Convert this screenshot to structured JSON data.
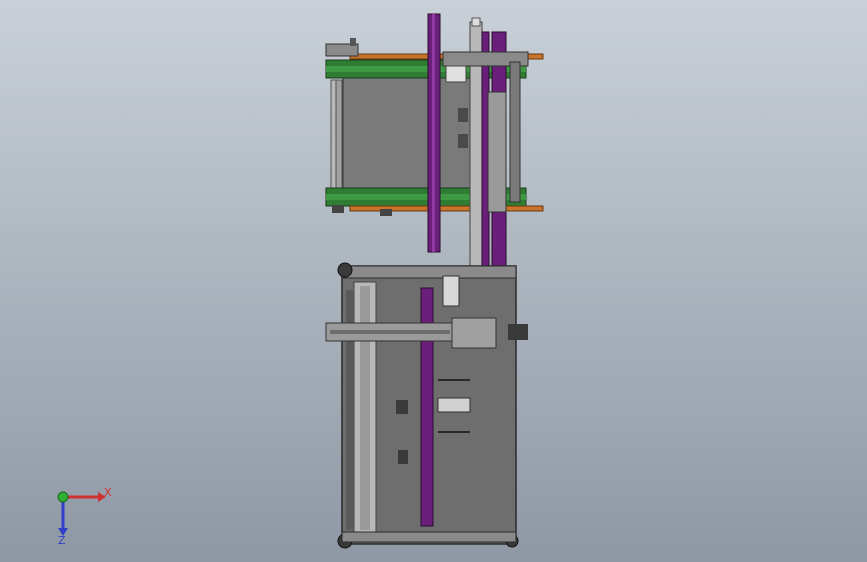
{
  "viewport": {
    "background_top": "#c9d0d8",
    "background_bottom": "#8e98a4"
  },
  "triad": {
    "x_label": "X",
    "z_label": "Z",
    "x_color": "#d03030",
    "y_color": "#30b030",
    "z_color": "#3040c8"
  },
  "colors": {
    "frame_gray": "#6e6e6e",
    "panel_gray": "#7a7a7a",
    "dark_gray": "#4a4a4a",
    "green_belt": "#2e7d32",
    "orange_rail": "#c8742c",
    "purple_rail": "#6a1f7a",
    "light_metal": "#b8b8b8"
  }
}
